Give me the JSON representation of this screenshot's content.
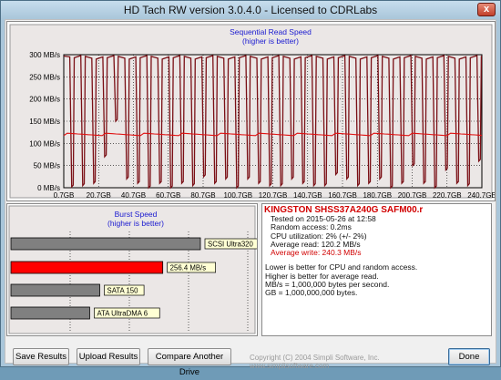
{
  "window": {
    "title": "HD Tach RW version 3.0.4.0 - Licensed to CDRLabs",
    "close_label": "x"
  },
  "read_chart": {
    "title": "Sequential Read Speed",
    "subtitle": "(higher is better)"
  },
  "burst_chart": {
    "title": "Burst Speed",
    "subtitle": "(higher is better)"
  },
  "info": {
    "drive": "KINGSTON SHSS37A240G SAFM00.r",
    "tested_on": "Tested on 2015-05-26 at 12:58",
    "random_access": "Random access: 0.2ms",
    "cpu": "CPU utilization: 2% (+/- 2%)",
    "avg_read": "Average read: 120.2 MB/s",
    "avg_write": "Average write: 240.3 MB/s",
    "note1": "Lower is better for CPU and random access.",
    "note2": "Higher is better for average read.",
    "note3": "MB/s = 1,000,000 bytes per second.",
    "note4": "GB = 1,000,000,000 bytes."
  },
  "buttons": {
    "save": "Save Results",
    "upload": "Upload Results",
    "compare": "Compare Another Drive",
    "done": "Done"
  },
  "copyright": "Copyright (C) 2004 Simpli Software, Inc. www.simplisoftware.com",
  "colors": {
    "read_line": "#e01010",
    "write_line": "#7a0f15",
    "burst_bar": "#ff0000",
    "ref_bar": "#808080"
  },
  "chart_data": [
    {
      "type": "line",
      "title": "Sequential Read Speed",
      "subtitle": "(higher is better)",
      "x_tick_labels": [
        "0.7GB",
        "20.7GB",
        "40.7GB",
        "60.7GB",
        "80.7GB",
        "100.7GB",
        "120.7GB",
        "140.7GB",
        "160.7GB",
        "180.7GB",
        "200.7GB",
        "220.7GB",
        "240.7GB"
      ],
      "xlim": [
        0.7,
        240.7
      ],
      "y_tick_labels": [
        "0 MB/s",
        "50 MB/s",
        "100 MB/s",
        "150 MB/s",
        "200 MB/s",
        "250 MB/s",
        "300 MB/s"
      ],
      "ylim": [
        0,
        300
      ],
      "grid": true,
      "series": [
        {
          "role": "read",
          "value": 120.2
        },
        {
          "role": "write",
          "high": 300,
          "dip_lows": [
            2,
            5,
            10,
            70,
            150,
            20,
            10,
            0,
            10,
            0,
            10,
            5,
            25,
            10,
            20,
            0,
            20,
            10,
            5,
            5,
            20,
            10,
            5,
            5,
            30,
            20,
            5,
            10,
            20,
            0,
            10,
            50,
            10,
            0,
            40,
            10,
            5,
            60
          ]
        }
      ]
    },
    {
      "type": "bar",
      "orientation": "horizontal",
      "title": "Burst Speed",
      "subtitle": "(higher is better)",
      "categories": [
        "SCSI Ultra320",
        "256.4 MB/s",
        "SATA 150",
        "ATA UltraDMA 6"
      ],
      "values": [
        320,
        256.4,
        150,
        133
      ],
      "highlight_index": 1,
      "xlim": [
        0,
        400
      ],
      "grid": true
    }
  ]
}
